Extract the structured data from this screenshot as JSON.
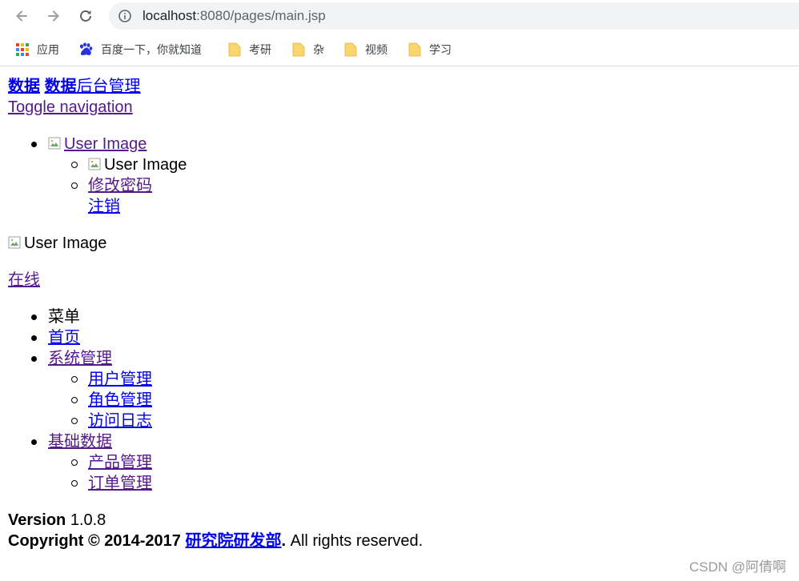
{
  "browser": {
    "url_host": "localhost",
    "url_rest": ":8080/pages/main.jsp",
    "icons": [
      "back-arrow-icon",
      "forward-arrow-icon",
      "reload-icon",
      "info-icon"
    ],
    "bookmarks": [
      {
        "label": "应用",
        "icon": "apps-grid-icon"
      },
      {
        "label": "百度一下，你就知道",
        "icon": "baidu-paw-icon"
      },
      {
        "label": "考研",
        "icon": "folder-icon"
      },
      {
        "label": "杂",
        "icon": "folder-icon"
      },
      {
        "label": "视频",
        "icon": "folder-icon"
      },
      {
        "label": "学习",
        "icon": "folder-icon"
      }
    ]
  },
  "header": {
    "logo_mini": "数据",
    "logo_lg_bold": "数据",
    "logo_lg_rest": "后台管理",
    "toggle_nav": "Toggle navigation"
  },
  "user_menu": {
    "user_image_alt": "User Image",
    "dropdown_image_alt": "User Image",
    "change_password": "修改密码",
    "logout": "注销"
  },
  "sidebar": {
    "user_image_alt": "User Image",
    "status_link": "在线",
    "menu_header": "菜单",
    "items": [
      {
        "label": "首页"
      },
      {
        "label": "系统管理",
        "children": [
          "用户管理",
          "角色管理",
          "访问日志"
        ]
      },
      {
        "label": "基础数据",
        "children": [
          "产品管理",
          "订单管理"
        ]
      }
    ]
  },
  "footer": {
    "version_label": "Version",
    "version_number": " 1.0.8",
    "copyright_prefix": "Copyright © 2014-2017 ",
    "company_link": "研究院研发部",
    "copyright_suffix": ". All rights reserved."
  },
  "watermark": "CSDN @阿倩啊",
  "colors": {
    "link": "#0000ee",
    "visited_link": "#551a8b",
    "address_bar_bg": "#f1f3f4",
    "folder": "#f9d56e"
  }
}
